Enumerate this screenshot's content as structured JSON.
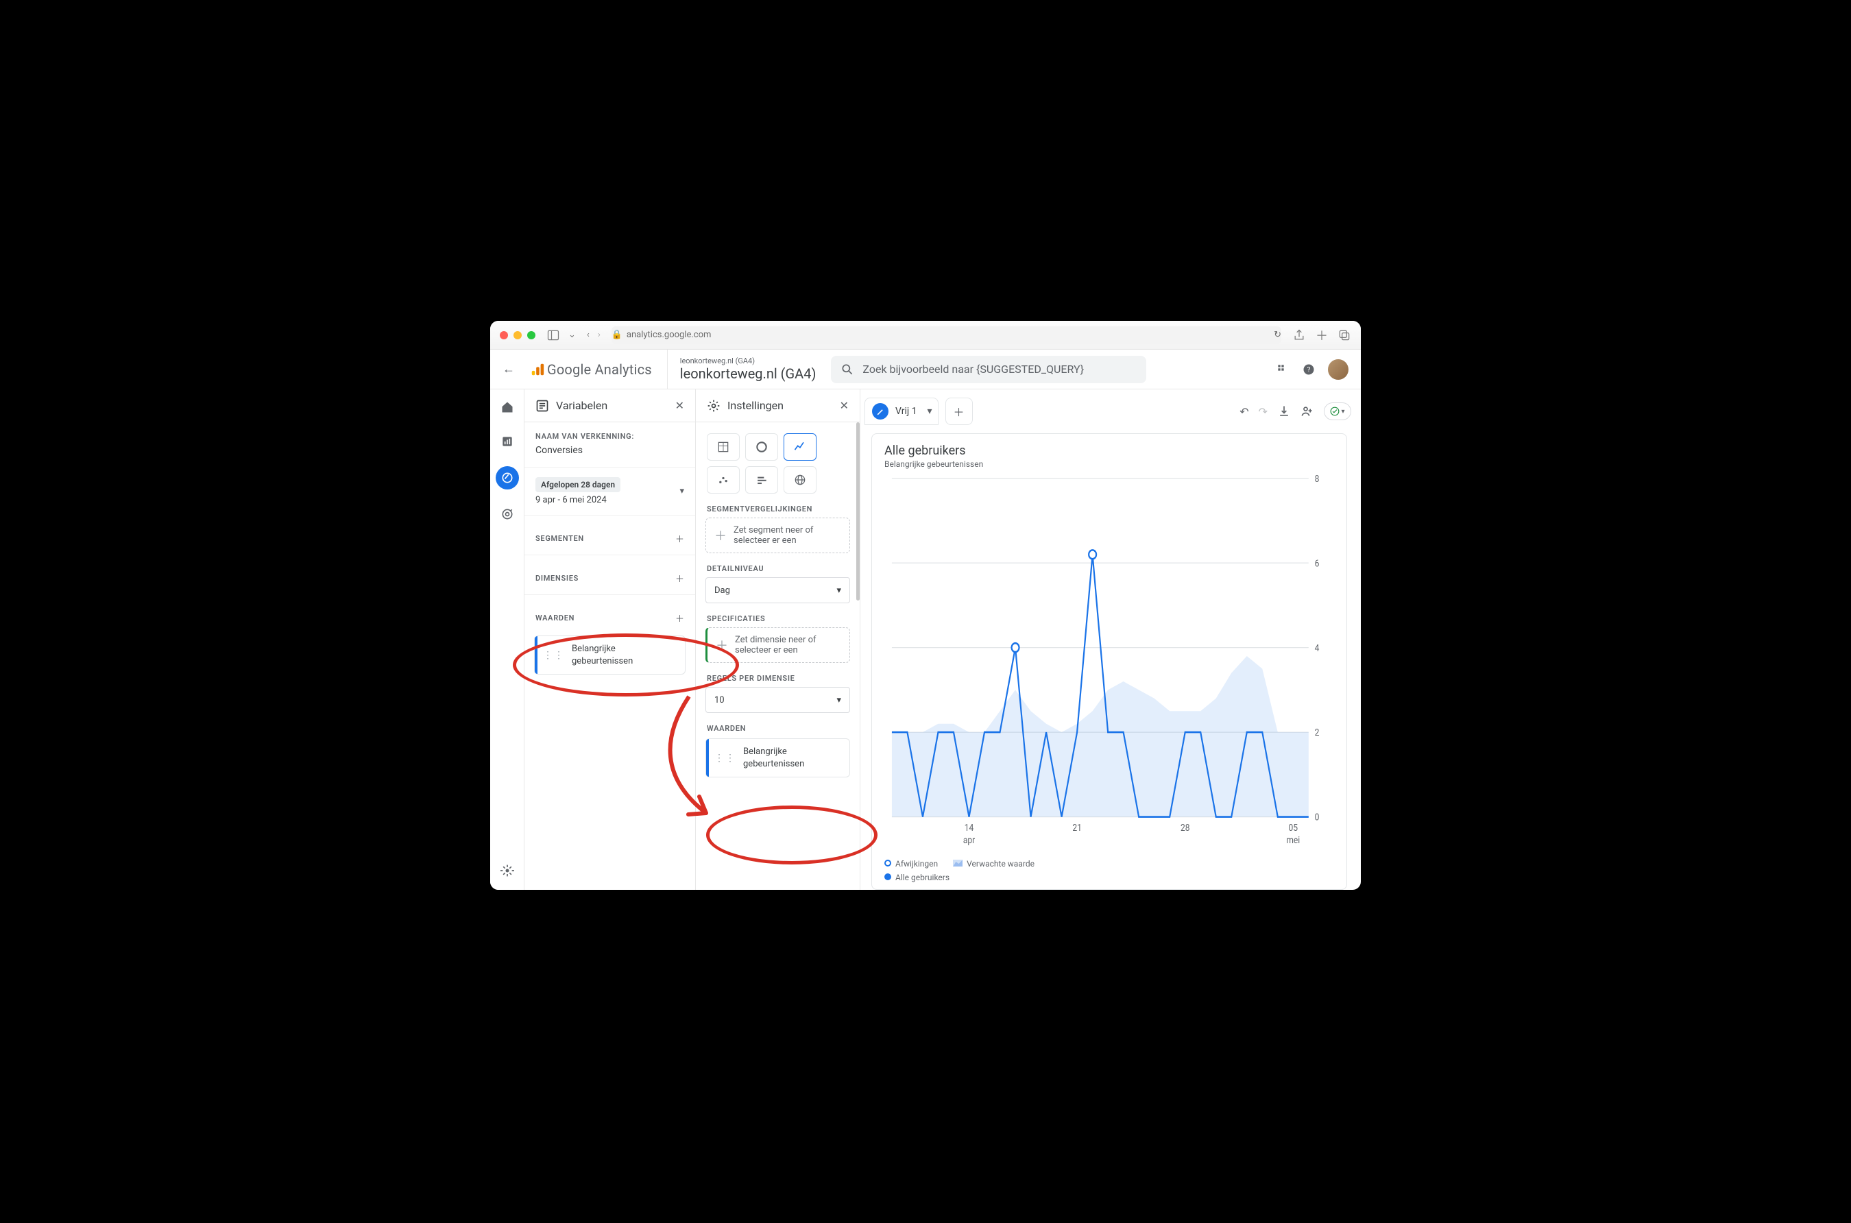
{
  "browser": {
    "url": "analytics.google.com"
  },
  "header": {
    "app_name": "Google Analytics",
    "property_sub": "leonkorteweg.nl (GA4)",
    "property_main": "leonkorteweg.nl (GA4)",
    "search_placeholder": "Zoek bijvoorbeeld naar {SUGGESTED_QUERY}"
  },
  "variabelen": {
    "panel_title": "Variabelen",
    "exploration_label": "NAAM VAN VERKENNING:",
    "exploration_name": "Conversies",
    "date_preset": "Afgelopen 28 dagen",
    "date_range": "9 apr - 6 mei 2024",
    "segments_label": "SEGMENTEN",
    "dimensions_label": "DIMENSIES",
    "metrics_label": "WAARDEN",
    "metric_card": "Belangrijke gebeurtenissen"
  },
  "instellingen": {
    "panel_title": "Instellingen",
    "segment_comparisons_label": "SEGMENTVERGELIJKINGEN",
    "segment_drop": "Zet segment neer of selecteer er een",
    "granularity_label": "DETAILNIVEAU",
    "granularity_value": "Dag",
    "specs_label": "SPECIFICATIES",
    "dimension_drop": "Zet dimensie neer of selecteer er een",
    "rows_label": "REGELS PER DIMENSIE",
    "rows_value": "10",
    "metrics_label": "WAARDEN",
    "metric_card": "Belangrijke gebeurtenissen"
  },
  "tabs": {
    "tab1": "Vrij 1"
  },
  "chart": {
    "title": "Alle gebruikers",
    "subtitle": "Belangrijke gebeurtenissen",
    "legend_anomaly": "Afwijkingen",
    "legend_expected": "Verwachte waarde",
    "legend_series": "Alle gebruikers"
  },
  "chart_data": {
    "type": "line",
    "title": "Alle gebruikers — Belangrijke gebeurtenissen",
    "xlabel": "",
    "ylabel": "",
    "ylim": [
      0,
      8
    ],
    "y_ticks": [
      0,
      2,
      4,
      6,
      8
    ],
    "x_tick_labels": [
      "14 apr",
      "21",
      "28",
      "05 mei"
    ],
    "x_tick_indices": [
      5,
      12,
      19,
      26
    ],
    "categories_days": 28,
    "series": [
      {
        "name": "Alle gebruikers",
        "values": [
          2,
          2,
          0,
          2,
          2,
          0,
          2,
          2,
          4,
          0,
          2,
          0,
          2,
          6.2,
          2,
          2,
          0,
          0,
          0,
          2,
          2,
          0,
          0,
          2,
          2,
          0,
          0,
          0
        ]
      }
    ],
    "expected_area": [
      2,
      2,
      2,
      2.2,
      2.2,
      2,
      2,
      2.5,
      3,
      2.5,
      2.2,
      2,
      2.2,
      2.5,
      3,
      3.2,
      3,
      2.8,
      2.5,
      2.5,
      2.5,
      2.8,
      3.4,
      3.8,
      3.5,
      2,
      2,
      2
    ],
    "anomaly_indices": [
      8,
      13
    ]
  }
}
